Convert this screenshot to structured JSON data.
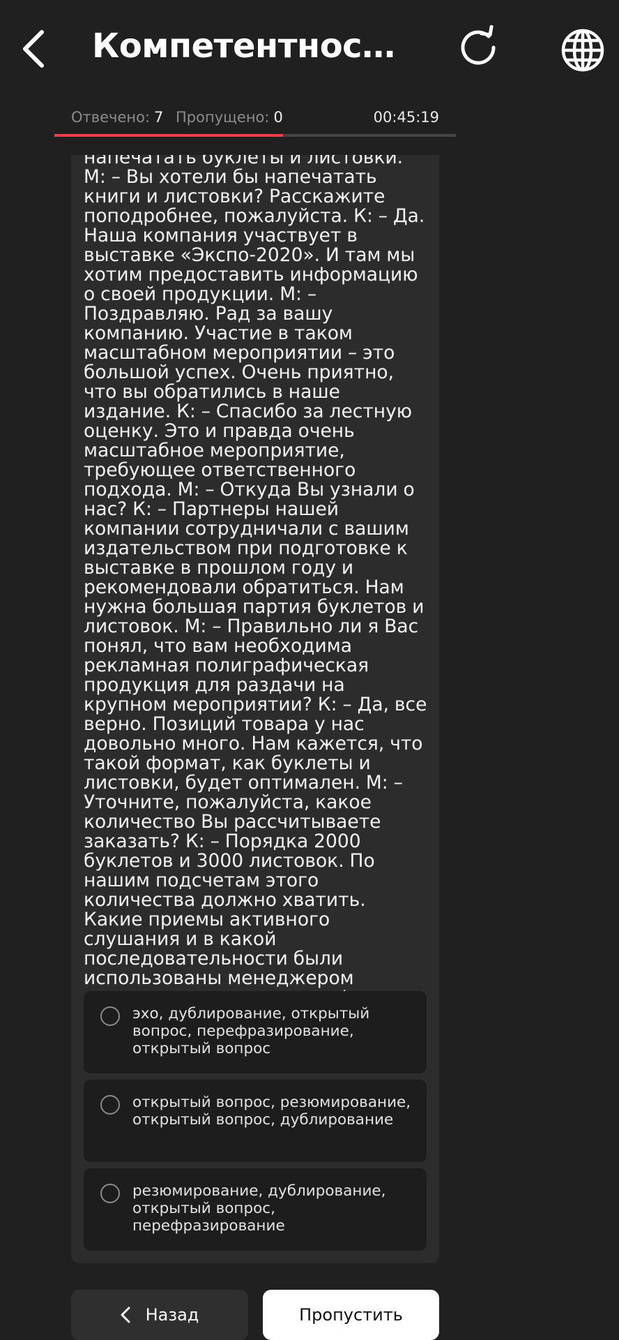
{
  "header": {
    "title": "Компетентностны...",
    "back_icon": "chevron-left-icon",
    "refresh_icon": "refresh-icon",
    "language_icon": "globe-icon"
  },
  "stats": {
    "answered_label": "Отвечено:",
    "answered_value": "7",
    "skipped_label": "Пропущено:",
    "skipped_value": "0",
    "timer": "00:45:19"
  },
  "progress": {
    "fraction": 0.57,
    "fill_color": "#ef3e4a"
  },
  "question": {
    "text": "напечатать буклеты и листовки. М: – Вы хотели бы напечатать книги и листовки? Расскажите поподробнее, пожалуйста. К: – Да. Наша компания участвует в выставке «Экспо-2020». И там мы хотим предоставить информацию о своей продукции. М: – Поздравляю. Рад за вашу компанию. Участие в таком масштабном мероприятии – это большой успех. Очень приятно, что вы обратились в наше издание. К: – Спасибо за лестную оценку. Это и правда очень масштабное мероприятие, требующее ответственного подхода. М: – Откуда Вы узнали о нас? К: – Партнеры нашей компании сотрудничали с вашим издательством при подготовке к выставке в прошлом году и рекомендовали обратиться. Нам нужна большая партия буклетов и листовок. М: – Правильно ли я Вас понял, что вам необходима рекламная полиграфическая продукция для раздачи на крупном мероприятии? К: – Да, все верно. Позиций товара у нас довольно много. Нам кажется, что такой формат, как буклеты и листовки, будет оптимален. М: – Уточните, пожалуйста, какое количество Вы рассчитываете заказать? К: – Порядка 2000 буклетов и 3000 листовок. По нашим подсчетам этого количества должно хватить. Какие приемы активного слушания и в какой последовательности были использованы менеджером издательства в ходе телефонного разговора с потенциальным клиентом?"
  },
  "options": [
    {
      "text": "эхо, дублирование, открытый вопрос, перефразирование, открытый вопрос",
      "selected": false
    },
    {
      "text": "открытый вопрос, резюмирование, открытый вопрос, дублирование",
      "selected": false
    },
    {
      "text": "резюмирование, дублирование, открытый вопрос, перефразирование",
      "selected": false
    }
  ],
  "footer": {
    "back_label": "Назад",
    "skip_label": "Пропустить"
  }
}
